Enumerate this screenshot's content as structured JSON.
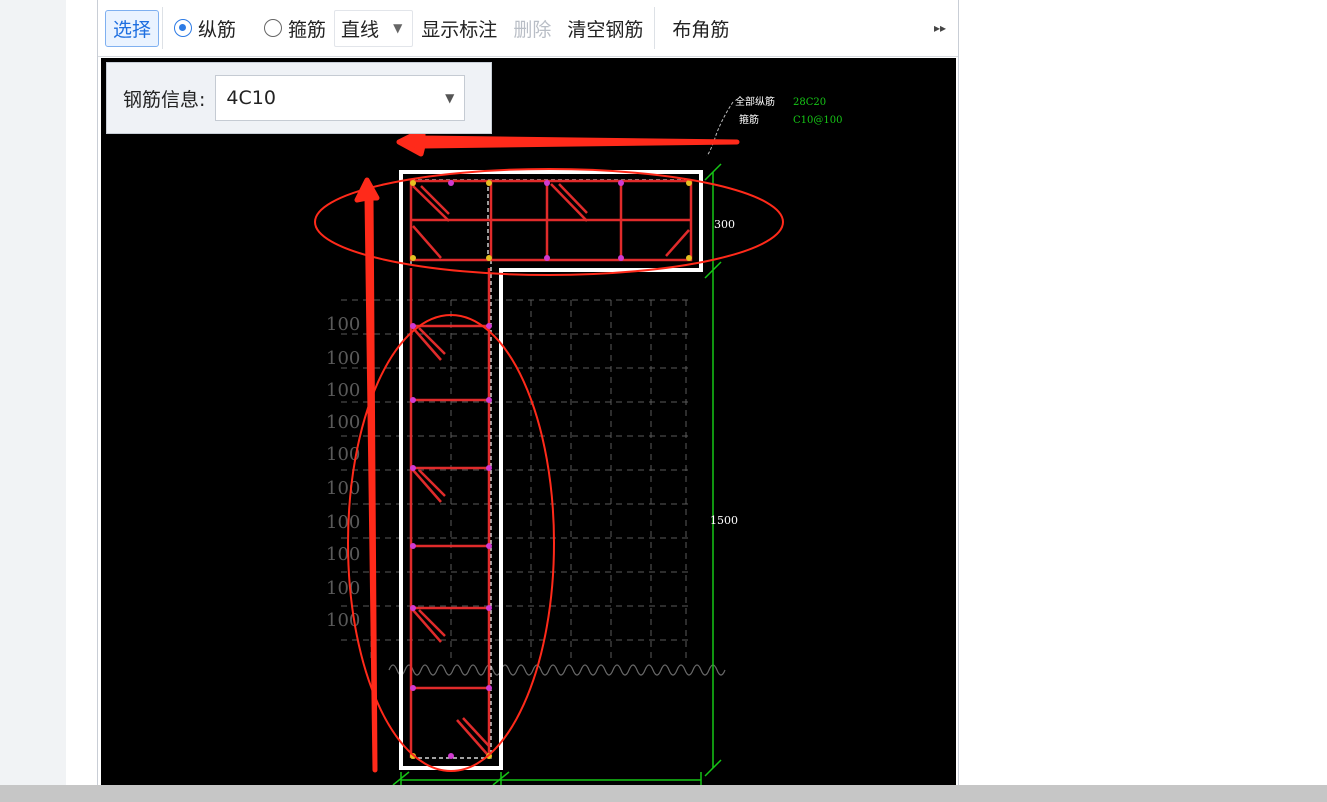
{
  "toolbar": {
    "select_label": "选择",
    "radio_longitudinal": "纵筋",
    "radio_stirrup": "箍筋",
    "line_mode": "直线",
    "show_annotation": "显示标注",
    "delete": "删除",
    "clear_rebar": "清空钢筋",
    "corner_rebar": "布角筋"
  },
  "info_panel": {
    "label": "钢筋信息:",
    "value": "4C10"
  },
  "drawing": {
    "legend_all_longitudinal_label": "全部纵筋",
    "legend_all_longitudinal_value": "28C20",
    "legend_stirrup_label": "箍筋",
    "legend_stirrup_value": "C10@100",
    "dim_flange_height": "300",
    "dim_web_height": "1500",
    "grid_labels": [
      "100",
      "100",
      "100",
      "100",
      "100",
      "100",
      "100",
      "100",
      "100",
      "100"
    ]
  },
  "colors": {
    "canvas_bg": "#000000",
    "rebar": "#e02b2b",
    "dimension": "#16c516",
    "annotation": "#ff2a1a",
    "accent": "#1e6fe0"
  }
}
